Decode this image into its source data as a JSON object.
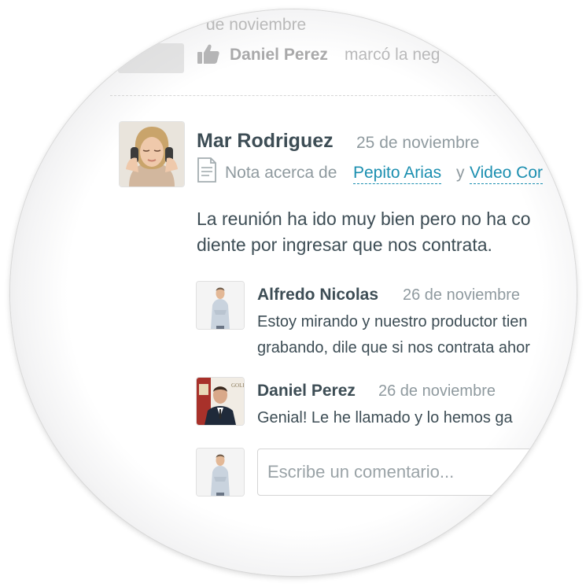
{
  "faded": {
    "date": "de noviembre",
    "liker_name": "Daniel Perez",
    "action": "marcó la neg"
  },
  "post": {
    "author": "Mar Rodriguez",
    "date": "25 de noviembre",
    "note_prefix": "Nota acerca de",
    "link_1": "Pepito Arias",
    "conjunction": "y",
    "link_2": "Video Cor",
    "body_line_1": "La reunión ha ido muy bien pero no ha co",
    "body_line_2": "diente por ingresar que nos contrata."
  },
  "comments": [
    {
      "author": "Alfredo Nicolas",
      "date": "26 de noviembre",
      "line_1": "Estoy mirando y nuestro productor tien",
      "line_2": "grabando, dile que si nos contrata ahor"
    },
    {
      "author": "Daniel Perez",
      "date": "26 de noviembre",
      "line_1": "Genial! Le he llamado y lo hemos ga"
    }
  ],
  "comment_box": {
    "placeholder": "Escribe un comentario..."
  },
  "icons": {
    "like": "thumbs-up-icon",
    "note": "document-icon"
  },
  "colors": {
    "text_dark": "#3d4d55",
    "text_muted": "#8f9a9f",
    "link": "#1b8fb0"
  }
}
